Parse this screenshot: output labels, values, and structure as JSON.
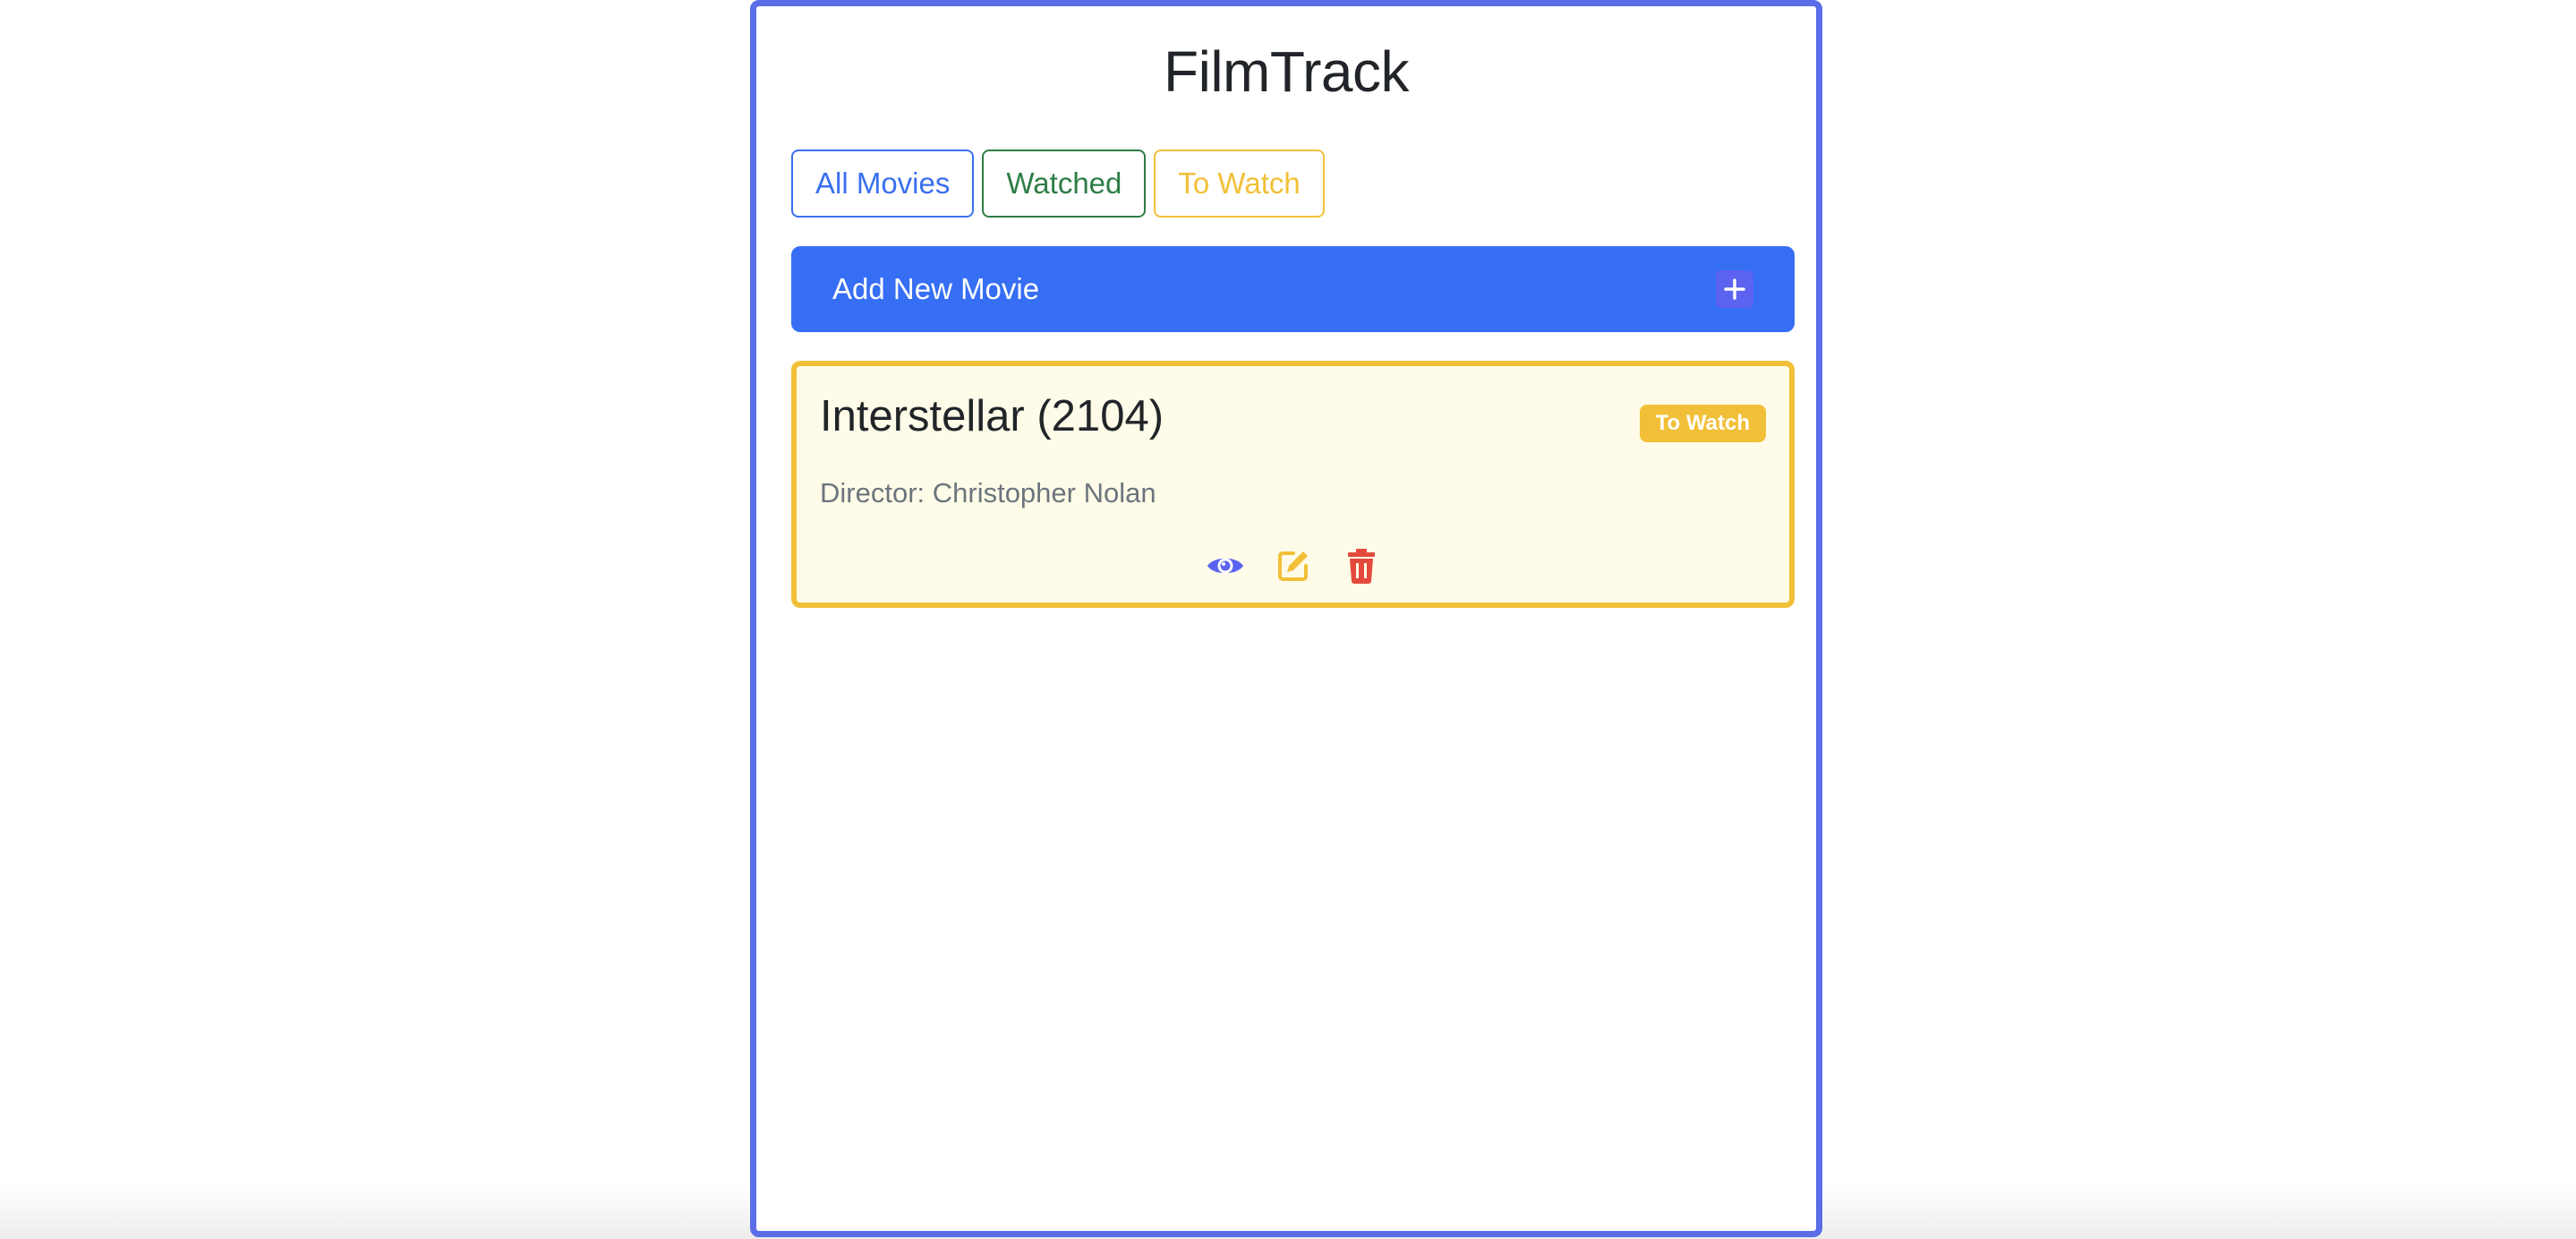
{
  "app": {
    "title": "FilmTrack"
  },
  "filters": [
    {
      "label": "All Movies",
      "color": "#3a6ff0"
    },
    {
      "label": "Watched",
      "color": "#2e7d45"
    },
    {
      "label": "To Watch",
      "color": "#f2c038"
    }
  ],
  "add_bar": {
    "label": "Add New Movie",
    "icon": "plus-icon",
    "color": "#366ef4"
  },
  "movies": [
    {
      "title": "Interstellar (2104)",
      "status": "To Watch",
      "director": "Director: Christopher Nolan",
      "actions": [
        {
          "icon": "eye-icon",
          "color": "#5b63f0"
        },
        {
          "icon": "edit-icon",
          "color": "#f2c038"
        },
        {
          "icon": "trash-icon",
          "color": "#e44a3c"
        }
      ]
    }
  ],
  "colors": {
    "accent": "#5b6ee8",
    "card_bg": "#fefbe8",
    "card_border": "#f2c038"
  }
}
